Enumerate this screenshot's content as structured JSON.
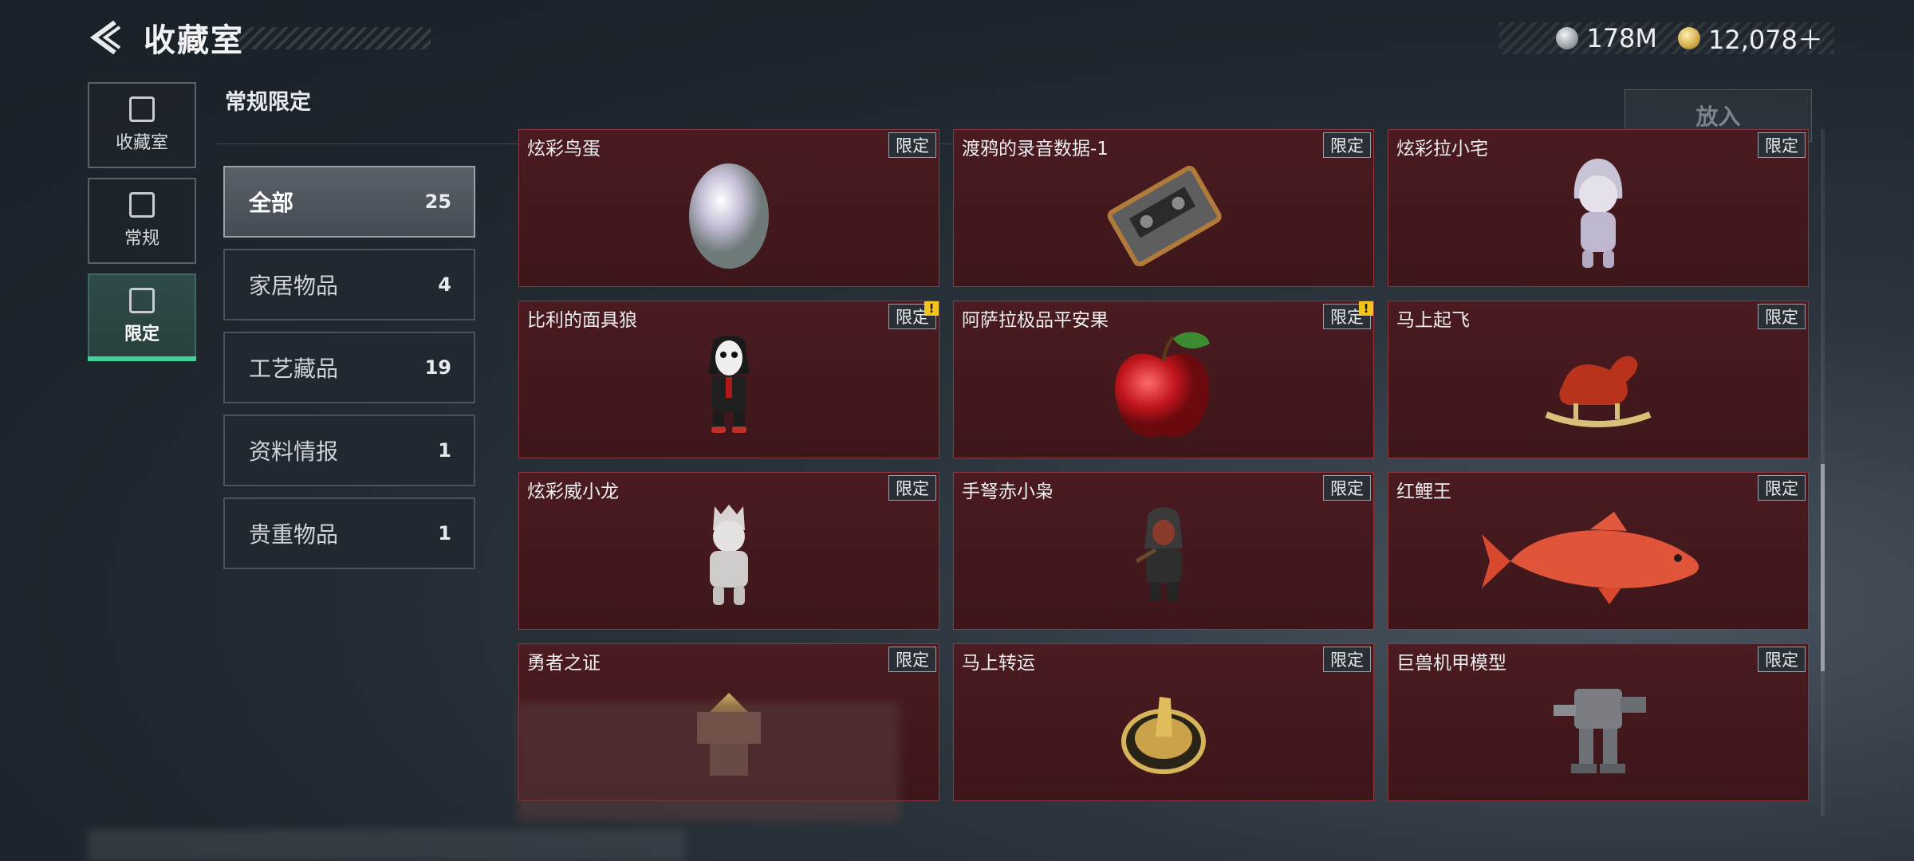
{
  "header": {
    "title": "收藏室",
    "currency": [
      {
        "icon": "silver-coin-icon",
        "value": "178M"
      },
      {
        "icon": "gold-coin-icon",
        "value": "12,078＋"
      }
    ]
  },
  "sidenav": [
    {
      "label": "收藏室",
      "icon": "collection-icon",
      "active": false
    },
    {
      "label": "常规",
      "icon": "regular-icon",
      "active": false
    },
    {
      "label": "限定",
      "icon": "limited-icon",
      "active": true
    }
  ],
  "section_title": "常规限定",
  "put_in_label": "放入",
  "categories": [
    {
      "label": "全部",
      "count": "25",
      "active": true
    },
    {
      "label": "家居物品",
      "count": "4"
    },
    {
      "label": "工艺藏品",
      "count": "19"
    },
    {
      "label": "资料情报",
      "count": "1"
    },
    {
      "label": "贵重物品",
      "count": "1"
    }
  ],
  "items": [
    {
      "name": "炫彩鸟蛋",
      "tag": "限定",
      "icon": "egg-icon"
    },
    {
      "name": "渡鸦的录音数据-1",
      "tag": "限定",
      "icon": "cassette-icon"
    },
    {
      "name": "炫彩拉小宅",
      "tag": "限定",
      "icon": "doll-icon"
    },
    {
      "name": "比利的面具狼",
      "tag": "限定",
      "icon": "puppet-icon",
      "warning": "!"
    },
    {
      "name": "阿萨拉极品平安果",
      "tag": "限定",
      "icon": "apple-icon",
      "warning": "!"
    },
    {
      "name": "马上起飞",
      "tag": "限定",
      "icon": "rocking-horse-icon"
    },
    {
      "name": "炫彩威小龙",
      "tag": "限定",
      "icon": "figure-icon"
    },
    {
      "name": "手弩赤小枭",
      "tag": "限定",
      "icon": "hooded-figure-icon"
    },
    {
      "name": "红鲤王",
      "tag": "限定",
      "icon": "carp-icon"
    },
    {
      "name": "勇者之证",
      "tag": "限定",
      "icon": "pyramid-icon"
    },
    {
      "name": "马上转运",
      "tag": "限定",
      "icon": "coin-medallion-icon"
    },
    {
      "name": "巨兽机甲模型",
      "tag": "限定",
      "icon": "mech-icon"
    }
  ],
  "colors": {
    "accent": "#3ed39a",
    "card_bg": "#4a1b20",
    "card_border": "#8a3a3e"
  }
}
